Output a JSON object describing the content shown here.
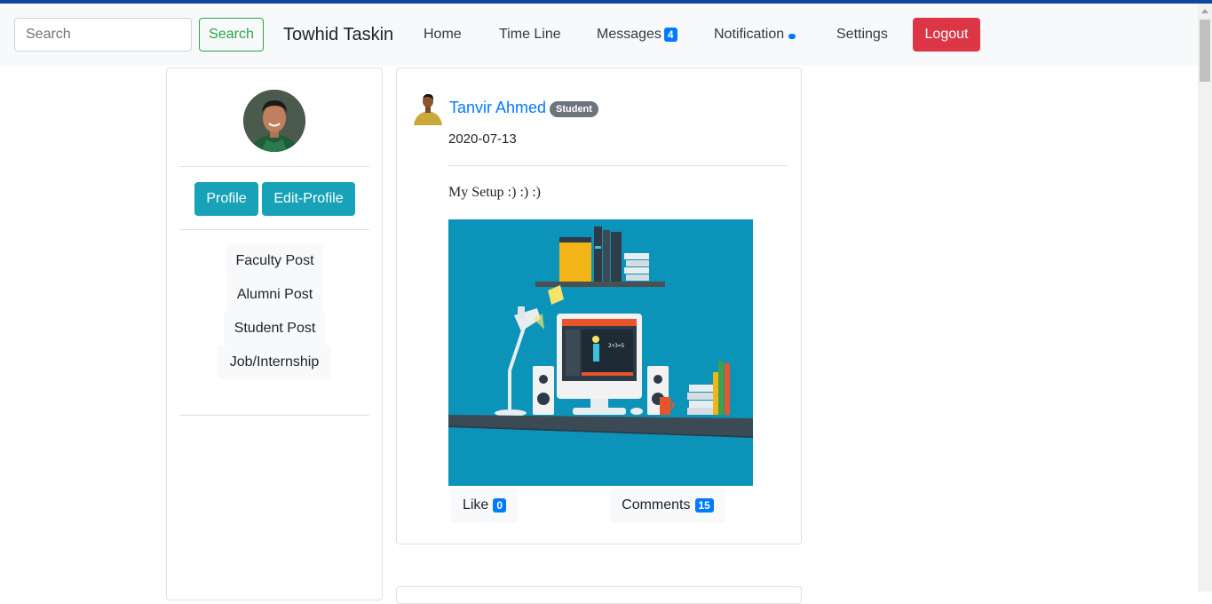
{
  "colors": {
    "top_stripe": "#0d47a1",
    "navbar_bg": "#f8f9fa",
    "success": "#28a745",
    "danger": "#dc3545",
    "info": "#17a2b8",
    "primary": "#007bff",
    "secondary": "#6c757d",
    "image_bg": "#0b93b9"
  },
  "navbar": {
    "search_placeholder": "Search",
    "search_button": "Search",
    "brand": "Towhid Taskin",
    "links": {
      "home": "Home",
      "timeline": "Time Line",
      "messages": "Messages",
      "messages_count": "4",
      "notification": "Notification",
      "settings": "Settings"
    },
    "logout": "Logout"
  },
  "sidebar": {
    "avatar_icon": "user-avatar",
    "profile_button": "Profile",
    "edit_profile_button": "Edit-Profile",
    "links": [
      "Faculty Post",
      "Alumni Post",
      "Student Post",
      "Job/Internship"
    ]
  },
  "post": {
    "author": "Tanvir Ahmed",
    "role_badge": "Student",
    "date": "2020-07-13",
    "text": "My Setup :) :) :)",
    "image_icon": "desk-setup-illustration",
    "like_label": "Like",
    "like_count": "0",
    "comments_label": "Comments",
    "comments_count": "15"
  }
}
